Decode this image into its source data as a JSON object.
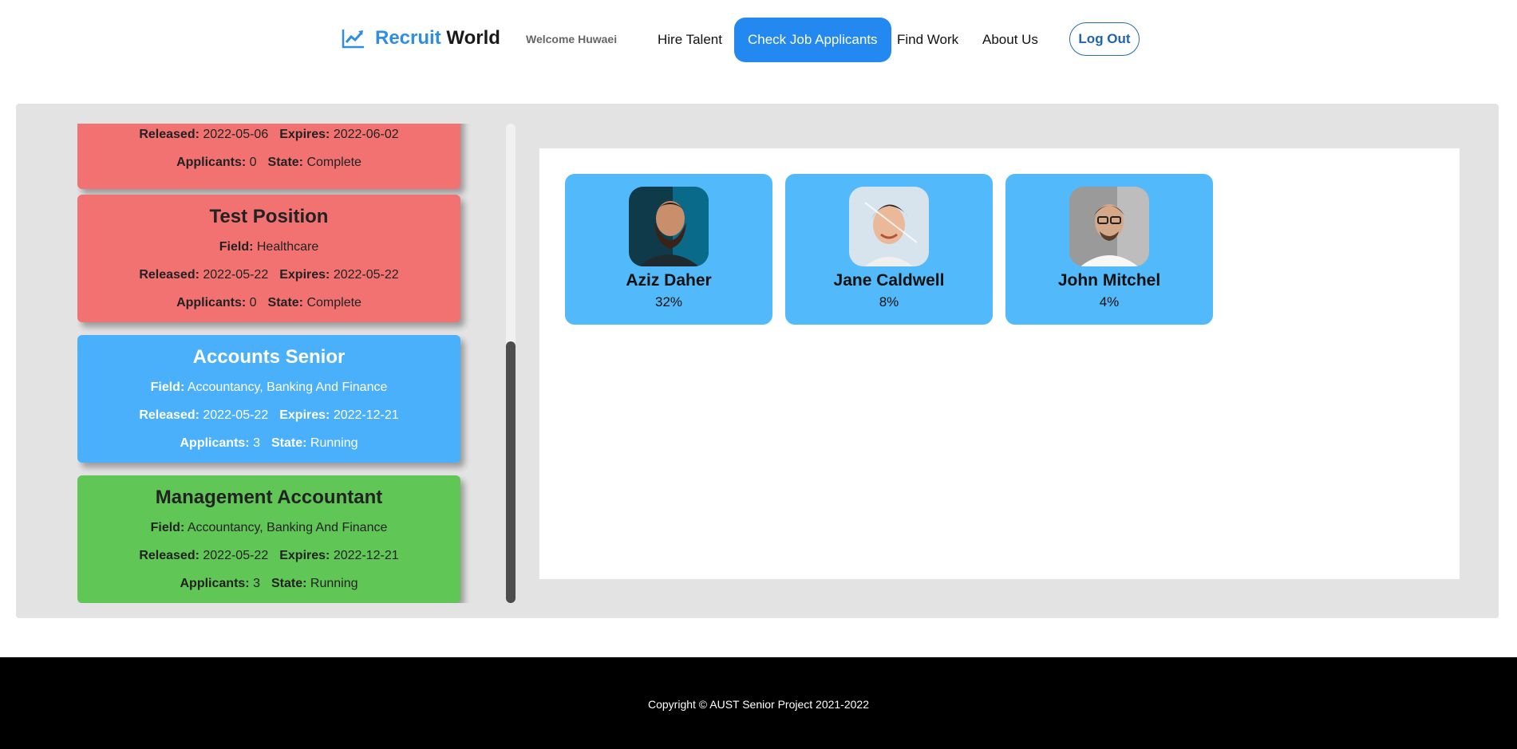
{
  "brand": {
    "part1": "Recruit",
    "part2": "World",
    "icon": "trending-up-icon"
  },
  "header": {
    "welcome": "Welcome Huwaei",
    "nav": [
      "Hire Talent",
      "Check Job Applicants",
      "Find Work",
      "About Us"
    ],
    "active_nav": "Check Job Applicants",
    "logout": "Log Out"
  },
  "labels": {
    "field": "Field:",
    "released": "Released:",
    "expires": "Expires:",
    "applicants": "Applicants:",
    "state": "State:"
  },
  "jobs": [
    {
      "title": "",
      "field": "",
      "released": "2022-05-06",
      "expires": "2022-06-02",
      "applicants": "0",
      "state": "Complete",
      "status": "complete"
    },
    {
      "title": "Test Position",
      "field": "Healthcare",
      "released": "2022-05-22",
      "expires": "2022-05-22",
      "applicants": "0",
      "state": "Complete",
      "status": "complete"
    },
    {
      "title": "Accounts Senior",
      "field": "Accountancy, Banking And Finance",
      "released": "2022-05-22",
      "expires": "2022-12-21",
      "applicants": "3",
      "state": "Running",
      "status": "selected"
    },
    {
      "title": "Management Accountant",
      "field": "Accountancy, Banking And Finance",
      "released": "2022-05-22",
      "expires": "2022-12-21",
      "applicants": "3",
      "state": "Running",
      "status": "running"
    }
  ],
  "applicants": [
    {
      "name": "Aziz Daher",
      "score": "32%"
    },
    {
      "name": "Jane Caldwell",
      "score": "8%"
    },
    {
      "name": "John Mitchel",
      "score": "4%"
    }
  ],
  "colors": {
    "complete": "#f27272",
    "selected": "#4bb0fb",
    "running": "#60c656",
    "accent": "#2388f0"
  },
  "footer": {
    "copyright": "Copyright © AUST Senior Project 2021-2022"
  }
}
